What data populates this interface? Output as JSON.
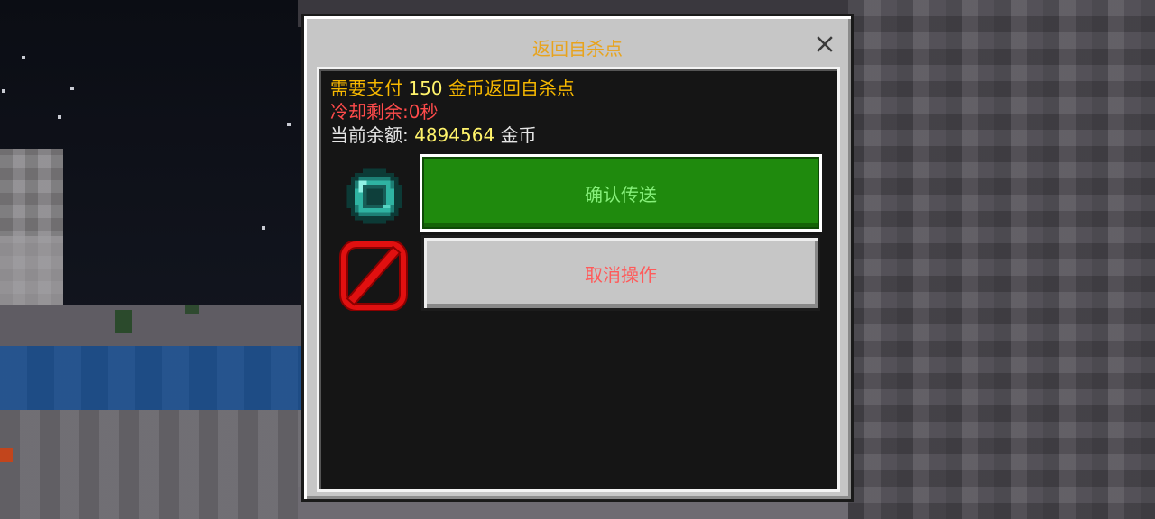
{
  "dialog": {
    "title": "返回自杀点",
    "close_icon": "close-icon"
  },
  "info": {
    "cost_prefix": "需要支付 ",
    "cost_value": "150",
    "cost_suffix": " 金币返回自杀点",
    "cooldown": "冷却剩余:0秒",
    "balance_prefix": "当前余额: ",
    "balance_value": "4894564",
    "balance_suffix": " 金币"
  },
  "buttons": {
    "confirm_label": "确认传送",
    "confirm_icon": "ender-pearl-icon",
    "cancel_label": "取消操作",
    "cancel_icon": "barrier-icon"
  },
  "colors": {
    "title": "#e8a31c",
    "cost_text": "#f7b800",
    "number_text": "#fff36b",
    "cooldown_text": "#ff4b4b",
    "confirm_bg": "#1f8a0d",
    "confirm_text": "#86f07a",
    "cancel_text": "#ff5a5a"
  }
}
